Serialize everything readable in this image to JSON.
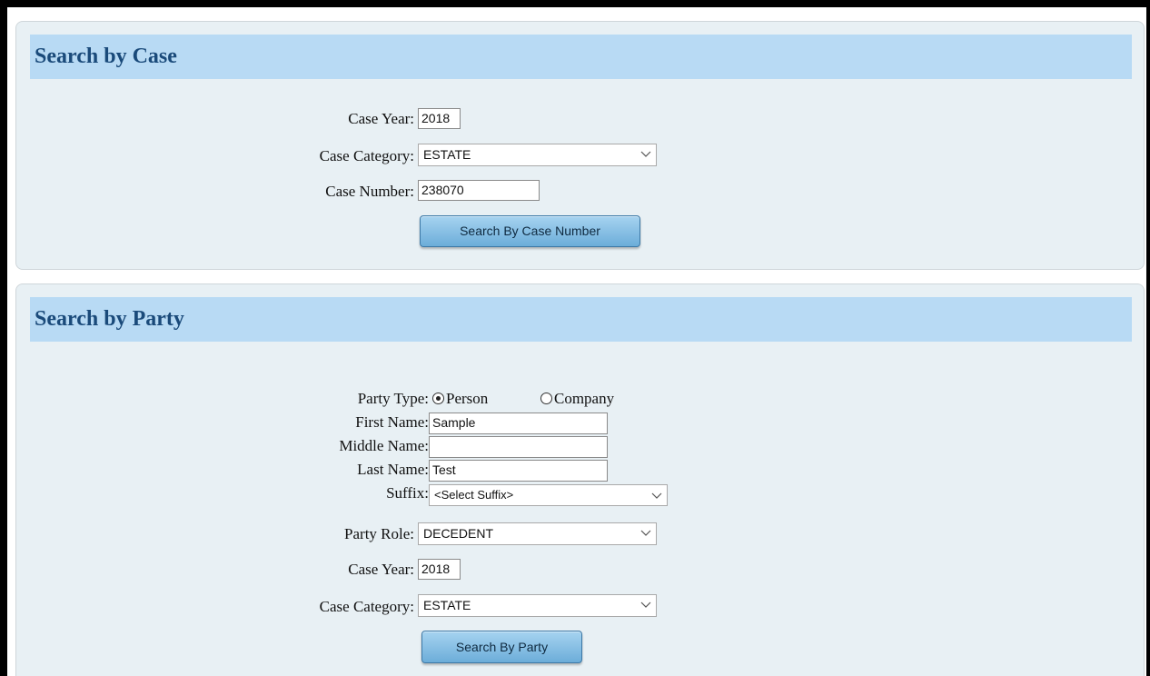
{
  "case_panel": {
    "title": "Search by Case",
    "case_year_label": "Case Year:",
    "case_year_value": "2018",
    "case_category_label": "Case Category:",
    "case_category_value": "ESTATE",
    "case_number_label": "Case Number:",
    "case_number_value": "238070",
    "search_button": "Search By Case Number"
  },
  "party_panel": {
    "title": "Search by Party",
    "party_type_label": "Party Type:",
    "party_type_options": [
      "Person",
      "Company"
    ],
    "party_type_selected": "Person",
    "first_name_label": "First Name:",
    "first_name_value": "Sample",
    "middle_name_label": "Middle Name:",
    "middle_name_value": "",
    "last_name_label": "Last Name:",
    "last_name_value": "Test",
    "suffix_label": "Suffix:",
    "suffix_value": "<Select Suffix>",
    "party_role_label": "Party Role:",
    "party_role_value": "DECEDENT",
    "case_year_label": "Case Year:",
    "case_year_value": "2018",
    "case_category_label": "Case Category:",
    "case_category_value": "ESTATE",
    "search_button": "Search By Party"
  },
  "icons": {
    "dropdown": "chevron-down-icon",
    "radio_on": "radio-selected",
    "radio_off": "radio-unselected"
  },
  "colors": {
    "header_bg": "#b8daf4",
    "title_text": "#1a4a7a",
    "panel_bg": "#e8f0f4",
    "button_bg": "#7cb8e0"
  }
}
